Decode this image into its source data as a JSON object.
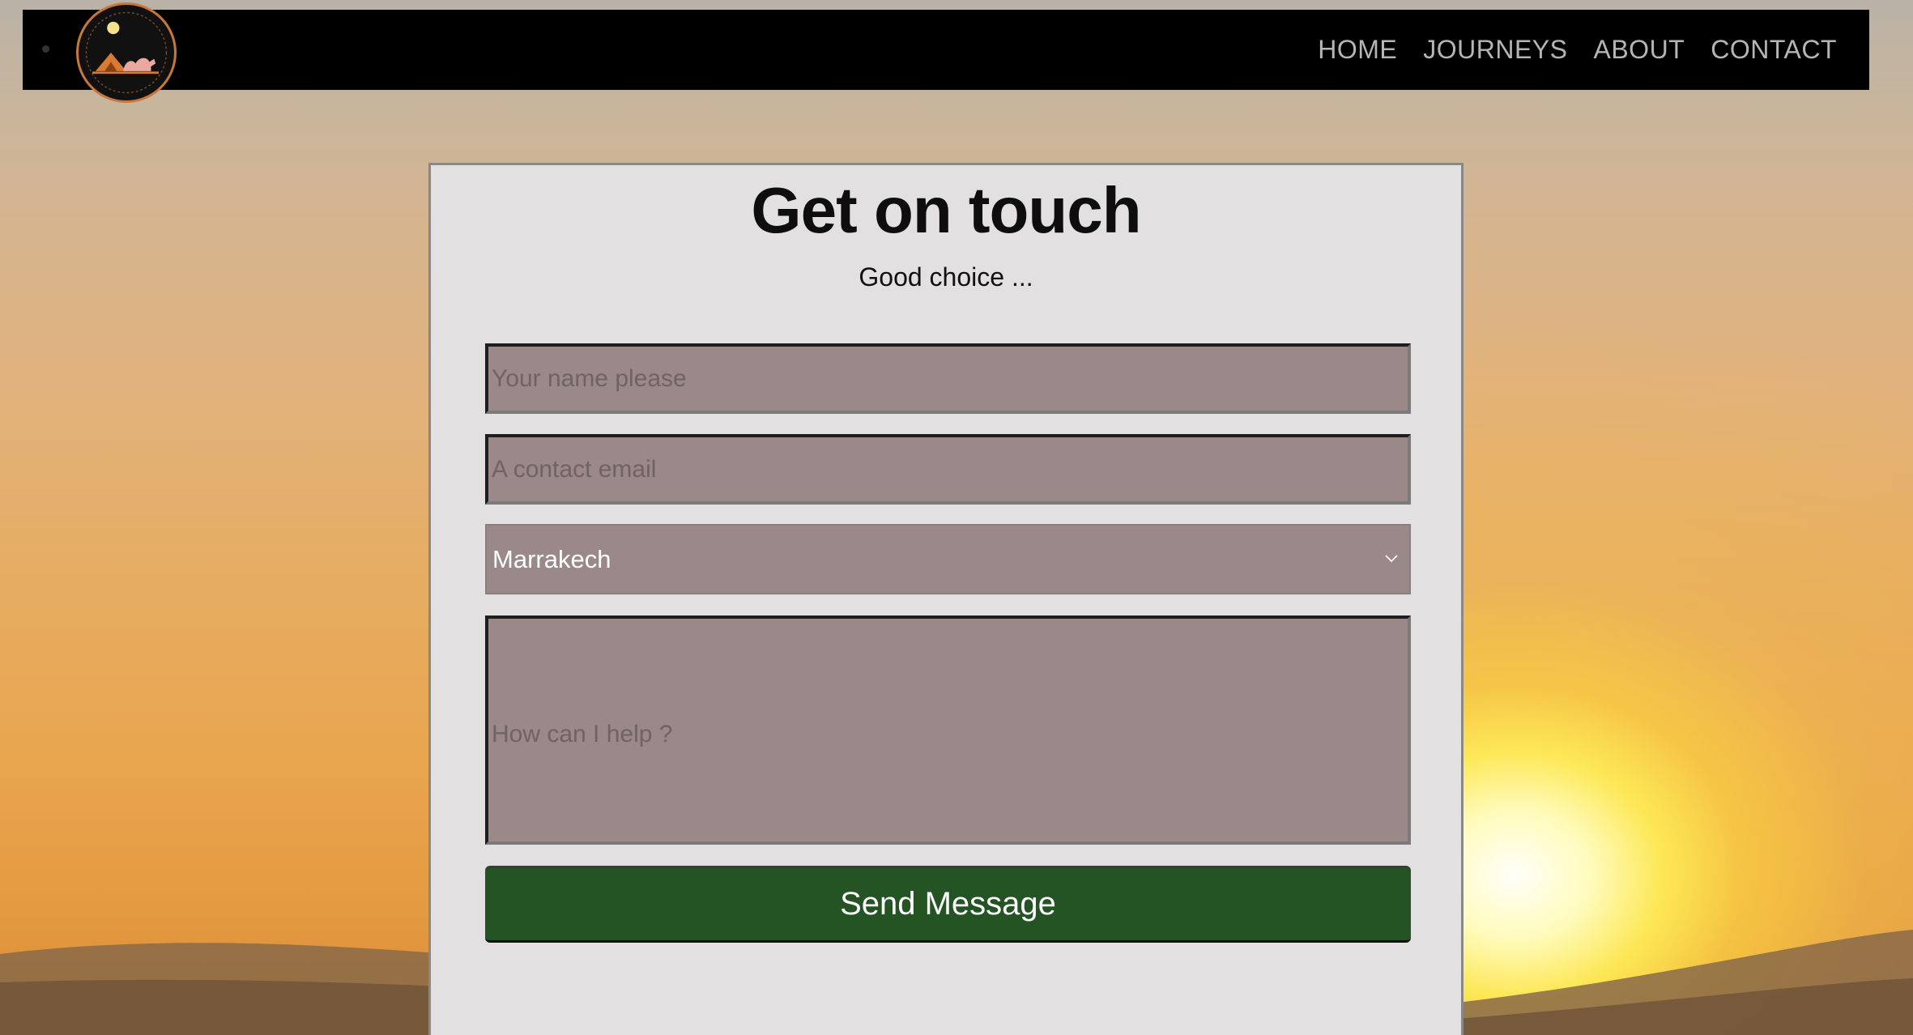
{
  "nav": {
    "links": [
      "HOME",
      "JOURNEYS",
      "ABOUT",
      "CONTACT"
    ]
  },
  "logo": {
    "icon": "camel-tent-logo-icon"
  },
  "form": {
    "title": "Get on touch",
    "subtitle": "Good choice ...",
    "name_placeholder": "Your name please",
    "email_placeholder": "A contact email",
    "destination_selected": "Marrakech",
    "message_placeholder": "How can I help ?",
    "send_label": "Send Message"
  },
  "colors": {
    "navbar": "#000000",
    "card": "#e2e0e1",
    "field": "#9b8888",
    "button": "#245424"
  }
}
